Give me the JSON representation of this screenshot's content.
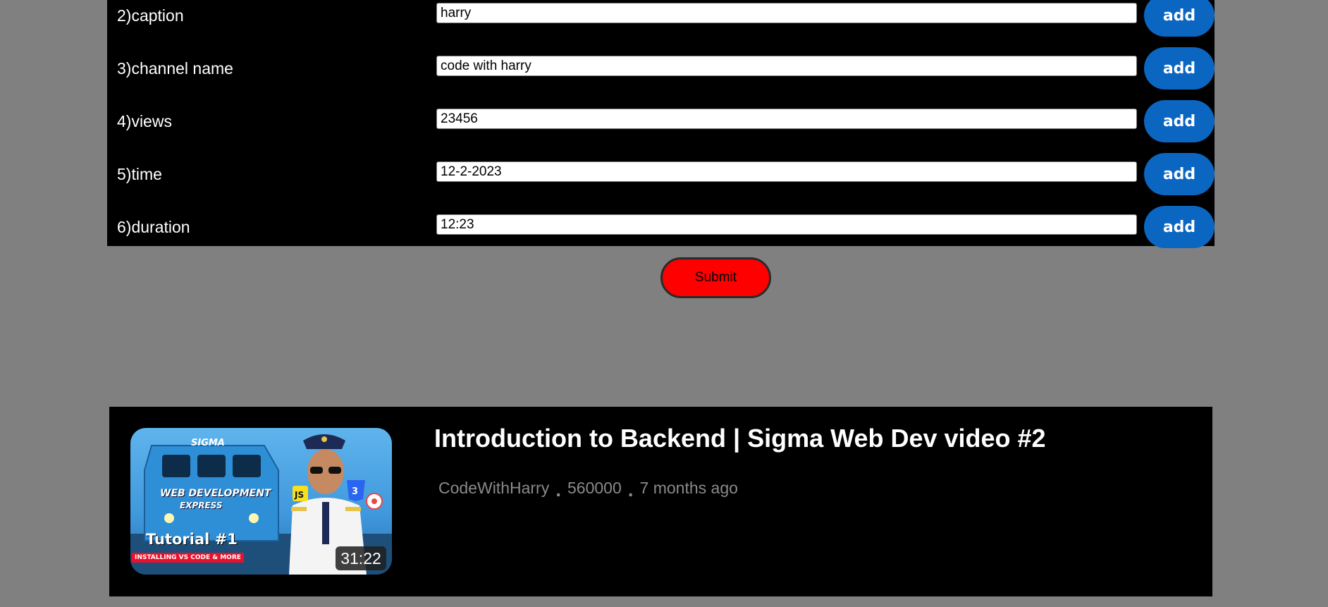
{
  "form": {
    "rows": [
      {
        "label": "2)caption",
        "value": "harry",
        "button": "add"
      },
      {
        "label": "3)channel name",
        "value": "code with harry",
        "button": "add"
      },
      {
        "label": "4)views",
        "value": "23456",
        "button": "add"
      },
      {
        "label": "5)time",
        "value": "12-2-2023",
        "button": "add"
      },
      {
        "label": "6)duration",
        "value": "12:23",
        "button": "add"
      }
    ],
    "submit_label": "Submit"
  },
  "video": {
    "thumbnail": {
      "brand": "SIGMA",
      "line1": "WEB DEVELOPMENT",
      "line2": "EXPRESS",
      "episode": "Tutorial #1",
      "subtitle": "INSTALLING VS CODE & MORE",
      "badge_js": "JS"
    },
    "duration": "31:22",
    "title": "Introduction to Backend | Sigma Web Dev video #2",
    "channel": "CodeWithHarry",
    "separator": ".",
    "views": "560000",
    "time_ago": "7 months ago"
  },
  "colors": {
    "page_bg": "#808080",
    "panel_bg": "#000000",
    "add_button": "#0b66c2",
    "submit_button": "#ff0000",
    "meta_text": "#8a8a8a"
  }
}
